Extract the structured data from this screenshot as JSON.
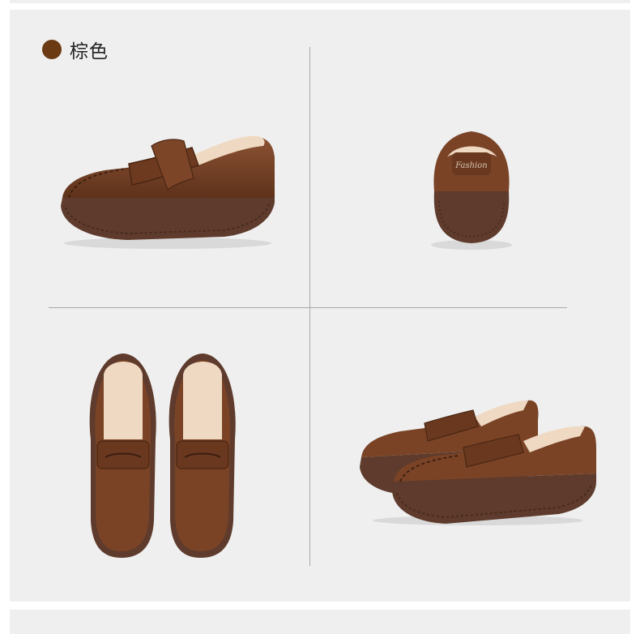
{
  "product": {
    "color_name": "棕色",
    "swatch_color": "#6b3a12",
    "leather_color": "#7a4326",
    "sole_color": "#5e3b2c",
    "lining_color": "#efd9c2"
  },
  "views": [
    {
      "id": "side",
      "icon": "loafer-side-view"
    },
    {
      "id": "back",
      "icon": "loafer-heel-view",
      "heel_text": "Fashion"
    },
    {
      "id": "top",
      "icon": "loafer-pair-top-view"
    },
    {
      "id": "pair",
      "icon": "loafer-pair-angled-view"
    }
  ]
}
